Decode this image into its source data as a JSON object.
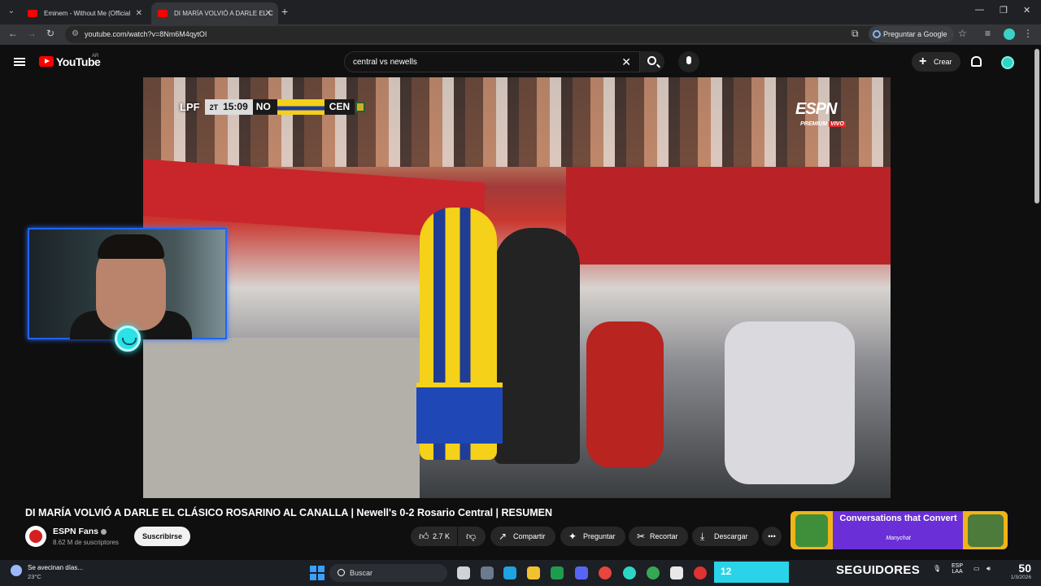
{
  "browser": {
    "tabs": [
      {
        "label": "Eminem - Without Me (Official",
        "active": false
      },
      {
        "label": "DI MARÍA VOLVIÓ A DARLE EL C",
        "active": true
      }
    ],
    "url": "youtube.com/watch?v=8Nm6M4qytOI",
    "google_button": "Preguntar a Google"
  },
  "youtube": {
    "logo": "YouTube",
    "country": "AR",
    "search_query": "central vs newells",
    "create_label": "Crear"
  },
  "video": {
    "scoreboard": {
      "league": "LPF",
      "half": "2T",
      "clock": "15:09",
      "team1": "NO",
      "team2": "CEN"
    },
    "broadcaster": "ESPN",
    "broadcaster_sub": "PREMIUM",
    "broadcaster_live": "VIVO",
    "title": "DI MARÍA VOLVIÓ A DARLE EL CLÁSICO ROSARINO AL CANALLA | Newell's 0-2 Rosario Central | RESUMEN"
  },
  "channel": {
    "name": "ESPN Fans",
    "subscribers": "8.62 M de suscriptores",
    "subscribe_label": "Suscribirse"
  },
  "actions": {
    "likes": "2.7 K",
    "share": "Compartir",
    "ask": "Preguntar",
    "clip": "Recortar",
    "download": "Descargar"
  },
  "ad": {
    "headline": "Conversations that Convert",
    "brand": "Manychat"
  },
  "taskbar": {
    "weather_text": "Se avecinan días...",
    "temperature": "23°C",
    "search_label": "Buscar",
    "counter_value": "12",
    "counter_label": "SEGUIDORES",
    "lang": "ESP",
    "lang_sub": "LAA",
    "clock": "50",
    "date": "1/3/2026"
  },
  "colors": {
    "yt_red": "#ff0000",
    "accent_cyan": "#29d4e8",
    "cam_border": "#1e63ff"
  }
}
